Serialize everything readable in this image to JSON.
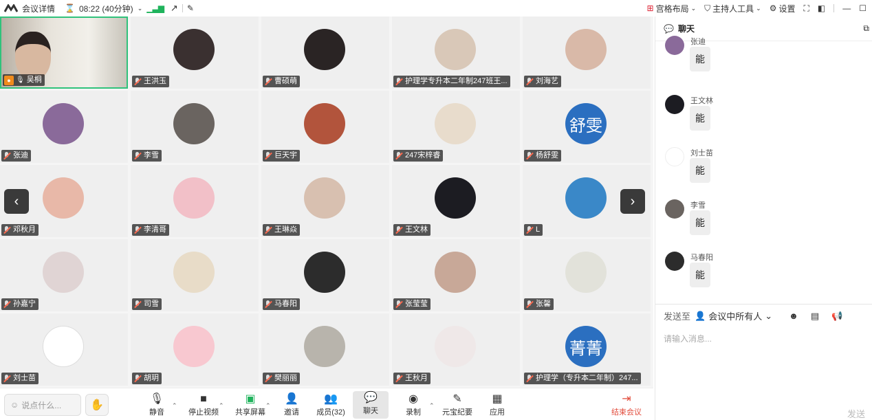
{
  "topbar": {
    "meeting_details": "会议详情",
    "timer": "08:22 (40分钟)",
    "layout_label": "宫格布局",
    "host_tools_label": "主持人工具",
    "settings_label": "设置"
  },
  "participants": [
    {
      "name": "吴桐",
      "color": "#cfc8ba"
    },
    {
      "name": "王洪玉",
      "color": "#3a3030"
    },
    {
      "name": "曹硕萌",
      "color": "#2a2424"
    },
    {
      "name": "护理学专升本二年制247班王...",
      "color": "#d9c8b8"
    },
    {
      "name": "刘海艺",
      "color": "#d9b9a8"
    },
    {
      "name": "张迪",
      "color": "#8a6a9a"
    },
    {
      "name": "李雪",
      "color": "#6a6460"
    },
    {
      "name": "巨天宇",
      "color": "#b2543c"
    },
    {
      "name": "247宋梓睿",
      "color": "#e8dccc"
    },
    {
      "name": "杨舒雯",
      "color": "#2b6fc0",
      "initials": "舒雯"
    },
    {
      "name": "邓秋月",
      "color": "#e8b8a8"
    },
    {
      "name": "李清哥",
      "color": "#f2c0c8"
    },
    {
      "name": "王琳焱",
      "color": "#d8c0b0"
    },
    {
      "name": "王文林",
      "color": "#1c1c22"
    },
    {
      "name": "L",
      "color": "#3a88c8"
    },
    {
      "name": "孙嘉宁",
      "color": "#e0d4d4"
    },
    {
      "name": "司雪",
      "color": "#e8dcc8"
    },
    {
      "name": "马春阳",
      "color": "#2c2c2c"
    },
    {
      "name": "张莹莹",
      "color": "#c8a898"
    },
    {
      "name": "张馨",
      "color": "#e2e2da"
    },
    {
      "name": "刘士苗",
      "color": "#ffffff"
    },
    {
      "name": "胡玥",
      "color": "#f8c8d0"
    },
    {
      "name": "樊丽丽",
      "color": "#b8b4ac"
    },
    {
      "name": "王秋月",
      "color": "#efe8e8"
    },
    {
      "name": "护理学（专升本二年制）247...",
      "color": "#2b6fc0",
      "initials": "菁菁"
    }
  ],
  "toolbar": {
    "say_something": "说点什么...",
    "mute": "静音",
    "stop_video": "停止视频",
    "share_screen": "共享屏幕",
    "invite": "邀请",
    "members": "成员(32)",
    "chat": "聊天",
    "record": "录制",
    "yuanbao": "元宝纪要",
    "apps": "应用",
    "end_meeting": "结束会议"
  },
  "chat": {
    "title": "聊天",
    "messages": [
      {
        "sender": "张迪",
        "text": "能",
        "color": "#8a6a9a"
      },
      {
        "sender": "王文林",
        "text": "能",
        "color": "#1c1c22"
      },
      {
        "sender": "刘士苗",
        "text": "能",
        "color": "#ffffff"
      },
      {
        "sender": "李雪",
        "text": "能",
        "color": "#6a6460"
      },
      {
        "sender": "马春阳",
        "text": "能",
        "color": "#2c2c2c"
      }
    ],
    "send_to_label": "发送至",
    "send_to_target": "会议中所有人",
    "input_placeholder": "请输入消息...",
    "send_button": "发送"
  }
}
